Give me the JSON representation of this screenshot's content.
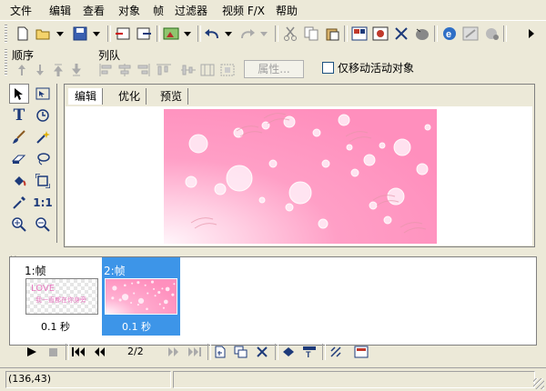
{
  "menu": [
    "文件",
    "编辑",
    "查看",
    "对象",
    "帧",
    "过滤器",
    "视频 F/X",
    "帮助"
  ],
  "toolbar2": {
    "order_label": "顺序",
    "align_label": "列队",
    "properties_button": "属性...",
    "move_active_label": "仅移动活动对象",
    "move_active_checked": false
  },
  "editor": {
    "tabs": [
      "编辑",
      "优化",
      "预览"
    ],
    "active_tab": 0
  },
  "frames": [
    {
      "label": "1:帧",
      "delay": "0.1 秒",
      "selected": false,
      "thumb_text": "LOVE",
      "thumb_text2": "我一直都在你身旁"
    },
    {
      "label": "2:帧",
      "delay": "0.1 秒",
      "selected": true
    }
  ],
  "playback": {
    "frame_counter": "2/2"
  },
  "status": {
    "coords": "(136,43)"
  },
  "icons": {
    "new": "new-file-icon",
    "open": "open-folder-icon",
    "save": "save-icon",
    "undo": "undo-icon",
    "redo": "redo-icon",
    "cut": "cut-icon",
    "copy": "copy-icon",
    "paste": "paste-icon"
  },
  "colors": {
    "selected_frame": "#3d95e8",
    "accent": "#ff8fbd"
  }
}
